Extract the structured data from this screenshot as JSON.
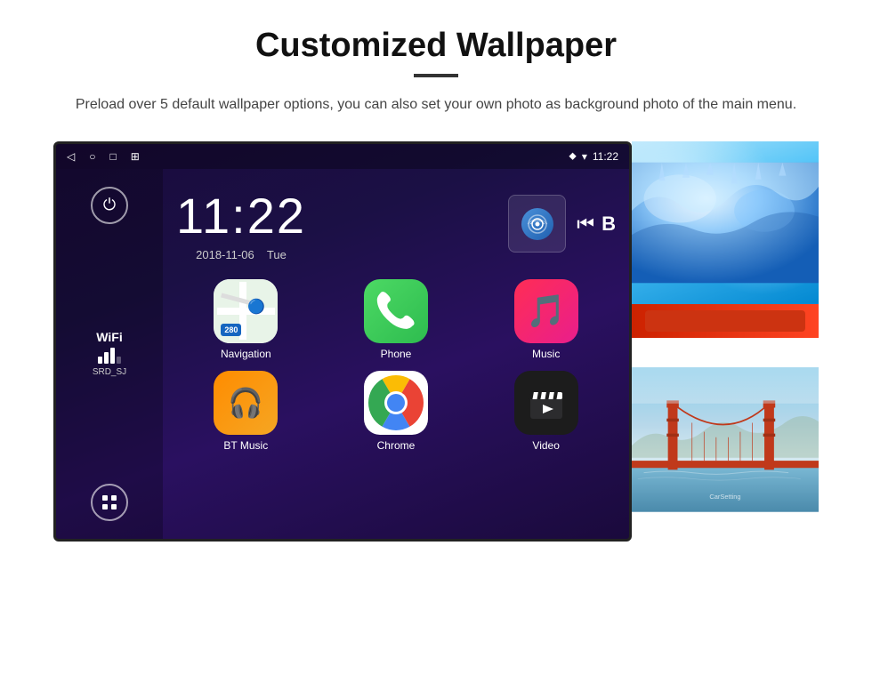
{
  "page": {
    "title": "Customized Wallpaper",
    "subtitle": "Preload over 5 default wallpaper options, you can also set your own photo as background photo of the main menu.",
    "divider": "—"
  },
  "android": {
    "status_bar": {
      "back_icon": "◁",
      "home_icon": "○",
      "recents_icon": "□",
      "screenshot_icon": "⊞",
      "location_icon": "⬥",
      "wifi_icon": "▾",
      "time": "11:22"
    },
    "clock": {
      "time": "11:22",
      "date": "2018-11-06",
      "day": "Tue"
    },
    "sidebar": {
      "power_icon": "⏻",
      "wifi_label": "WiFi",
      "wifi_signal": "▌▌▌",
      "wifi_ssid": "SRD_SJ",
      "apps_icon": "⊞"
    },
    "apps": [
      {
        "id": "navigation",
        "label": "Navigation",
        "type": "nav"
      },
      {
        "id": "phone",
        "label": "Phone",
        "type": "phone"
      },
      {
        "id": "music",
        "label": "Music",
        "type": "music"
      },
      {
        "id": "btmusic",
        "label": "BT Music",
        "type": "btmusic"
      },
      {
        "id": "chrome",
        "label": "Chrome",
        "type": "chrome"
      },
      {
        "id": "video",
        "label": "Video",
        "type": "video"
      }
    ]
  },
  "wallpapers": [
    {
      "id": "ice",
      "label": "Ice caves / blue"
    },
    {
      "id": "red",
      "label": "Red item"
    },
    {
      "id": "bridge",
      "label": "Golden Gate Bridge"
    }
  ],
  "colors": {
    "nav_bg": "#e8f4e8",
    "phone_green": "#4cd964",
    "music_pink": "#ff2d55",
    "btmusic_orange": "#ff8c00",
    "chrome_blue": "#4285f4",
    "video_dark": "#1c1c1e",
    "android_bg_start": "#1a0a3c",
    "android_bg_end": "#2a1060"
  }
}
